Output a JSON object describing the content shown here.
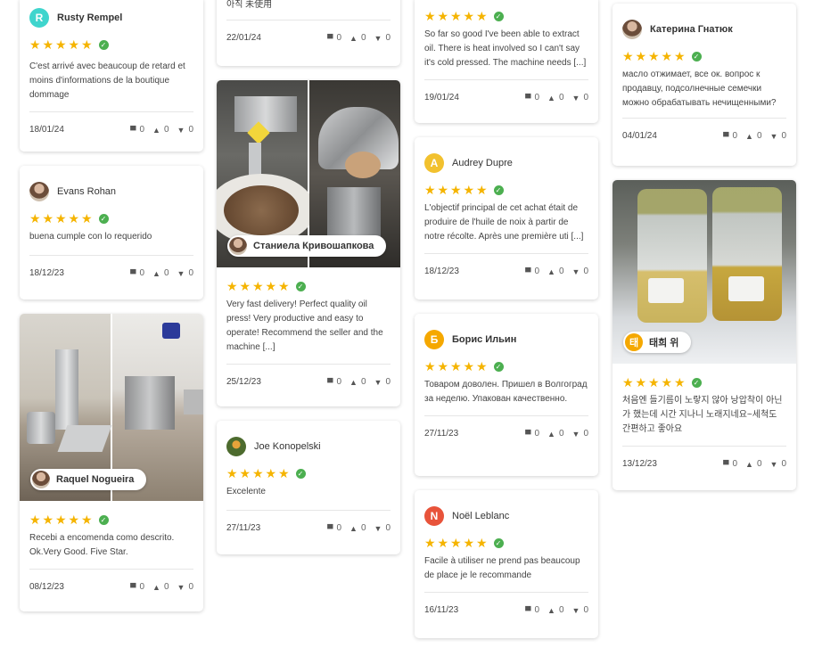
{
  "icons": {
    "comment": "comment-icon",
    "like": "thumbs-up-icon",
    "dislike": "thumbs-down-icon",
    "verified": "verified-check-icon",
    "star": "star-icon"
  },
  "colors": {
    "star": "#f5b400",
    "verified": "#4caf50"
  },
  "reviews": {
    "rusty": {
      "initial": "R",
      "avatar_color": "#3fd5cd",
      "name": "Rusty Rempel",
      "rating": 5,
      "text": "C'est arrivé avec beaucoup de retard et moins d'informations de la boutique dommage",
      "date": "18/01/24",
      "comments": "0",
      "likes": "0",
      "dislikes": "0"
    },
    "evans": {
      "name": "Evans Rohan",
      "rating": 5,
      "text": "buena cumple con lo requerido",
      "date": "18/12/23",
      "comments": "0",
      "likes": "0",
      "dislikes": "0"
    },
    "raquel": {
      "name": "Raquel Nogueira",
      "rating": 5,
      "text": "Recebi a encomenda como descrito. Ok.Very Good. Five Star.",
      "date": "08/12/23",
      "comments": "0",
      "likes": "0",
      "dislikes": "0"
    },
    "korean_top": {
      "text": "아직 未使用",
      "date": "22/01/24",
      "comments": "0",
      "likes": "0",
      "dislikes": "0"
    },
    "staniela": {
      "name": "Станиела Кривошапкова",
      "rating": 5,
      "text": "Very fast delivery! Perfect quality oil press! Very productive and easy to operate! Recommend the seller and the machine [...]",
      "date": "25/12/23",
      "comments": "0",
      "likes": "0",
      "dislikes": "0"
    },
    "joe": {
      "name": "Joe Konopelski",
      "rating": 5,
      "text": "Excelente",
      "date": "27/11/23",
      "comments": "0",
      "likes": "0",
      "dislikes": "0"
    },
    "top3": {
      "rating": 5,
      "text": "So far so good I've been able to extract oil. There is heat involved so I can't say it's cold pressed. The machine needs [...]",
      "date": "19/01/24",
      "comments": "0",
      "likes": "0",
      "dislikes": "0"
    },
    "audrey": {
      "initial": "A",
      "avatar_color": "#f2c12e",
      "name": "Audrey Dupre",
      "rating": 5,
      "text": "L'objectif principal de cet achat était de produire de l'huile de noix à partir de notre récolte. Après une première uti [...]",
      "date": "18/12/23",
      "comments": "0",
      "likes": "0",
      "dislikes": "0"
    },
    "boris": {
      "initial": "Б",
      "avatar_color": "#f5a800",
      "name": "Борис Ильин",
      "rating": 5,
      "text": "Товаром доволен. Пришел в Волгоград за неделю. Упакован качественно.",
      "date": "27/11/23",
      "comments": "0",
      "likes": "0",
      "dislikes": "0"
    },
    "noel": {
      "initial": "N",
      "avatar_color": "#e8533a",
      "name": "Noël Leblanc",
      "rating": 5,
      "text": "Facile à utiliser ne prend pas beaucoup de place je le recommande",
      "date": "16/11/23",
      "comments": "0",
      "likes": "0",
      "dislikes": "0"
    },
    "katerina": {
      "name": "Катерина Гнатюк",
      "rating": 5,
      "text": "масло отжимает, все ок. вопрос к продавцу, подсолнечные семечки можно обрабатывать нечищенными?",
      "date": "04/01/24",
      "comments": "0",
      "likes": "0",
      "dislikes": "0"
    },
    "taehee": {
      "initial": "태",
      "avatar_color": "#f5a800",
      "name": "태희 위",
      "rating": 5,
      "text": "처음엔 들기름이 노랗지 않아 낭압착이 아닌가 했는데 시간 지나니 노래지네요~세척도 간편하고 좋아요",
      "date": "13/12/23",
      "comments": "0",
      "likes": "0",
      "dislikes": "0"
    }
  }
}
